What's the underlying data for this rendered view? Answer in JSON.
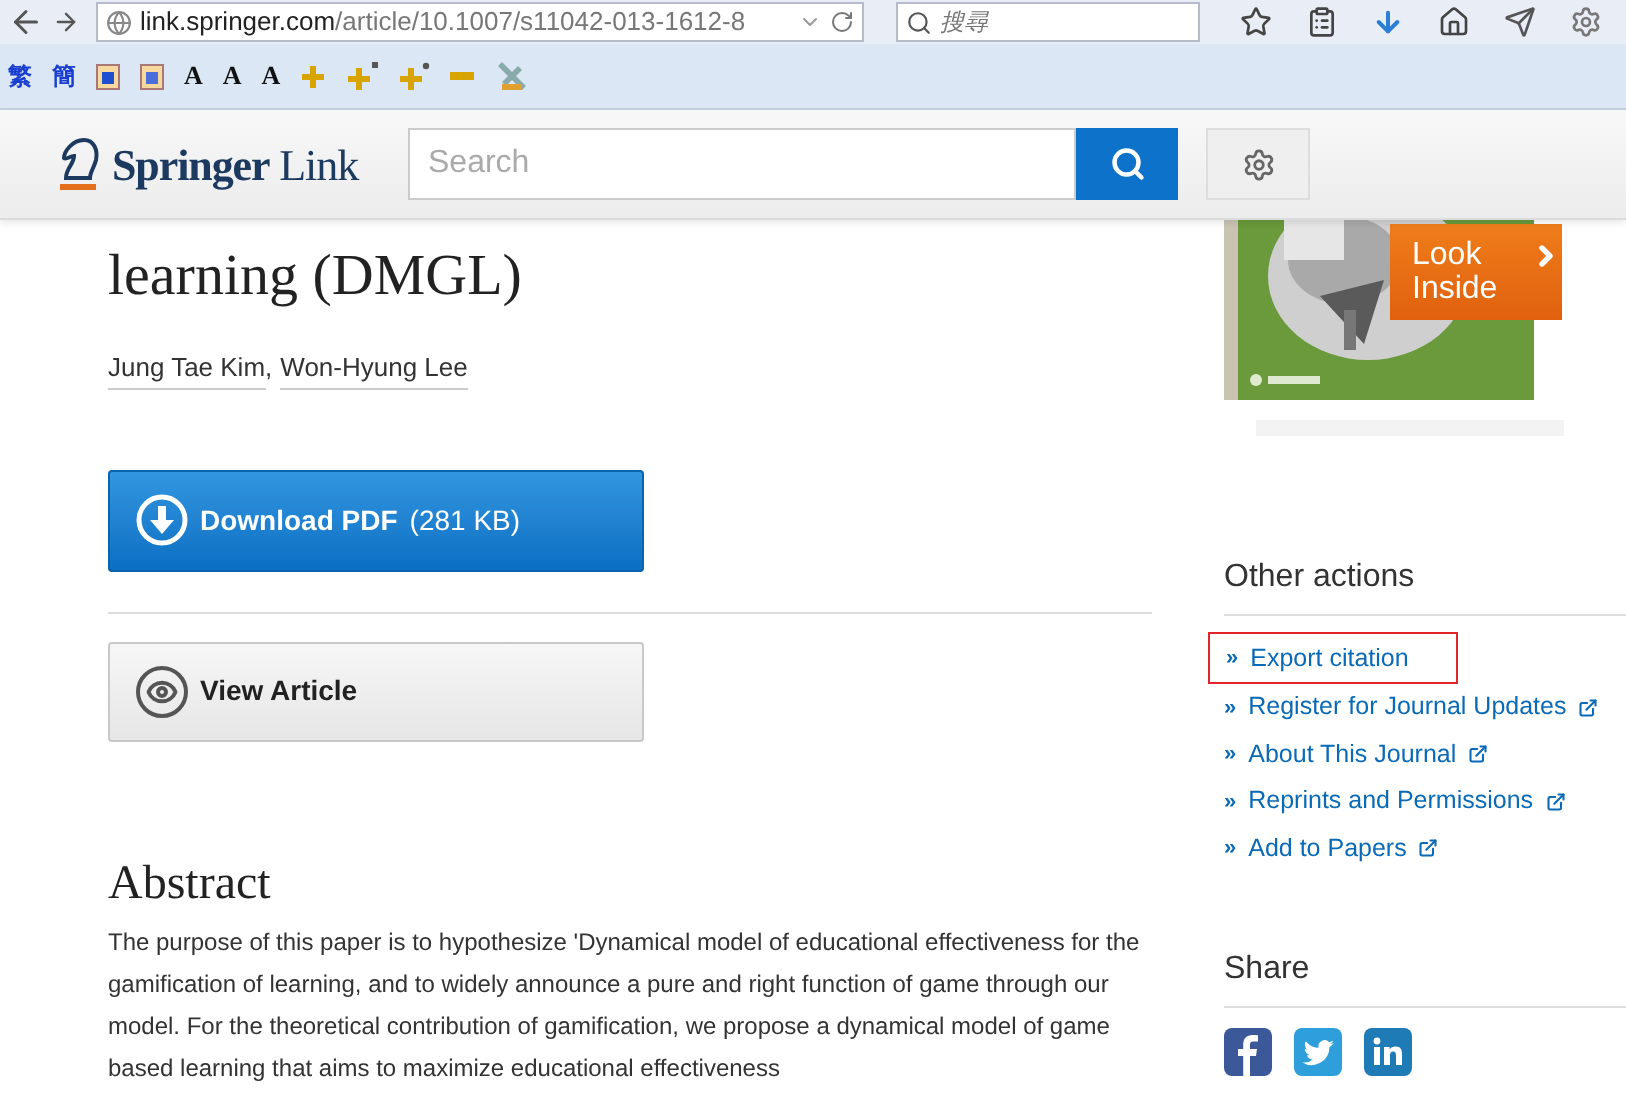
{
  "browser": {
    "url_host": "link.springer.com",
    "url_path": "/article/10.1007/s11042-013-1612-8",
    "search_placeholder": "搜尋"
  },
  "addon_toolbar": {
    "labels": [
      "繁",
      "簡"
    ],
    "font_buttons": [
      "A",
      "A",
      "A"
    ]
  },
  "header": {
    "logo_bold": "Springer",
    "logo_light": "Link",
    "search_placeholder": "Search"
  },
  "article": {
    "title_lines": [
      "learning (DMGL)"
    ],
    "authors": [
      "Jung Tae Kim",
      "Won-Hyung Lee"
    ],
    "author_separator": ",",
    "download": {
      "label": "Download PDF",
      "size": "(281 KB)"
    },
    "view": {
      "label": "View Article"
    },
    "abstract_heading": "Abstract",
    "abstract_text": "The purpose of this paper is to hypothesize 'Dynamical model of educational effectiveness for the gamification of learning, and to widely announce a pure and right function of game through our model. For the theoretical contribution of gamification, we propose a dynamical model of game based learning that aims to maximize educational effectiveness"
  },
  "sidebar": {
    "look_inside": [
      "Look",
      "Inside"
    ],
    "other_actions_heading": "Other actions",
    "actions": [
      {
        "label": "Export citation",
        "external": false,
        "highlighted": true
      },
      {
        "label": "Register for Journal Updates",
        "external": true,
        "highlighted": false
      },
      {
        "label": "About This Journal",
        "external": true,
        "highlighted": false
      },
      {
        "label": "Reprints and Permissions",
        "external": true,
        "highlighted": false
      },
      {
        "label": "Add to Papers",
        "external": true,
        "highlighted": false
      }
    ],
    "marker": "»",
    "share_heading": "Share",
    "share": [
      {
        "kind": "facebook"
      },
      {
        "kind": "twitter"
      },
      {
        "kind": "linkedin"
      }
    ]
  }
}
